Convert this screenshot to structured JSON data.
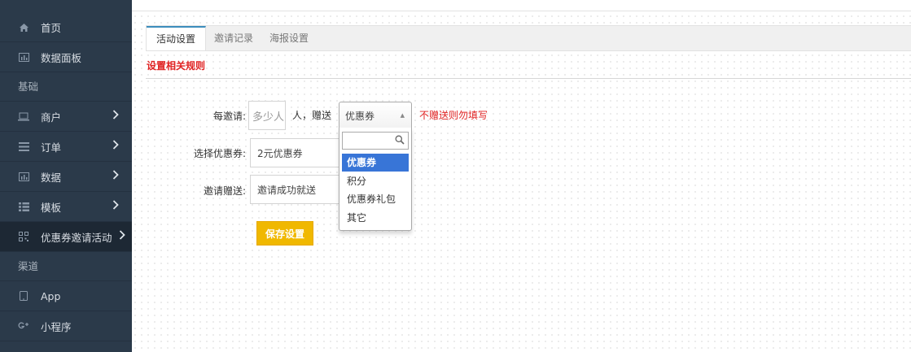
{
  "sidebar": {
    "items": [
      {
        "icon": "home-icon",
        "label": "首页"
      },
      {
        "icon": "bar-chart-icon",
        "label": "数据面板"
      },
      {
        "section": "基础"
      },
      {
        "icon": "laptop-icon",
        "label": "商户",
        "chevron": ">"
      },
      {
        "icon": "list-icon",
        "label": "订单",
        "chevron": ">"
      },
      {
        "icon": "bar-chart-icon",
        "label": "数据",
        "chevron": ">"
      },
      {
        "icon": "grid-list-icon",
        "label": "模板",
        "chevron": ">"
      },
      {
        "icon": "qrcode-icon",
        "label": "优惠券邀请活动",
        "chevron": ">"
      },
      {
        "section": "渠道"
      },
      {
        "icon": "tablet-icon",
        "label": "App"
      },
      {
        "icon": "google-plus-icon",
        "label": "小程序"
      }
    ]
  },
  "tabs": [
    "活动设置",
    "邀请记录",
    "海报设置"
  ],
  "rule_title": "设置相关规则",
  "form": {
    "per_invite_label": "每邀请:",
    "per_invite_placeholder": "多少人",
    "per_invite_suffix": "人，赠送",
    "gift_type_value": "优惠券",
    "gift_hint": "不赠送则勿填写",
    "coupon_label": "选择优惠券:",
    "coupon_value": "2元优惠券",
    "invite_gift_label": "邀请赠送:",
    "invite_gift_value": "邀请成功就送",
    "save_label": "保存设置"
  },
  "dropdown": {
    "options": [
      "优惠券",
      "积分",
      "优惠券礼包",
      "其它"
    ],
    "selected": "优惠券"
  },
  "colors": {
    "sidebar_bg": "#2b3a4a",
    "accent_red": "#e02222",
    "save_button": "#f0b800",
    "dropdown_highlight": "#3875d7"
  }
}
